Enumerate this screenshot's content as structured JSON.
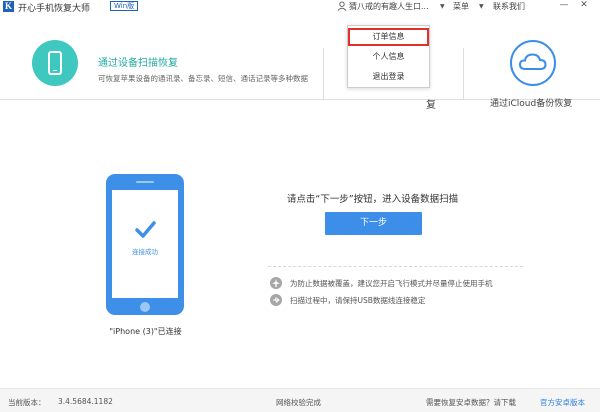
{
  "titlebar": {
    "logo_letter": "K",
    "app_title": "开心手机恢复大师",
    "edition": "Win版",
    "user_name": "猜八戒的有趣人生口...",
    "menu_label": "菜单",
    "contact_label": "联系我们",
    "minimize": "—",
    "close": "✕"
  },
  "options": {
    "device": {
      "title": "通过设备扫描恢复",
      "desc": "可恢复苹果设备的通讯录、备忘录、短信、通话记录等多种数据"
    },
    "itunes": {
      "title_tail": "复"
    },
    "icloud": {
      "title": "通过iCloud备份恢复"
    }
  },
  "dropdown": {
    "items": [
      "订单信息",
      "个人信息",
      "退出登录"
    ]
  },
  "main": {
    "connected_label": "连接成功",
    "device_caption": "\"iPhone (3)\"已连接",
    "instruction": "请点击“下一步”按钮，进入设备数据扫描",
    "next_button": "下一步",
    "tips": [
      "为防止数据被覆盖，建议您开启飞行模式并尽量停止使用手机",
      "扫描过程中，请保持USB数据线连接稳定"
    ]
  },
  "footer": {
    "version_label": "当前版本：",
    "version_value": "3.4.5684.1182",
    "network_status": "网络校验完成",
    "android_question": "需要恢复安卓数据？请下载",
    "android_link": "官方安卓版本"
  },
  "colors": {
    "brand_blue": "#3d8ee9",
    "teal": "#3ec8c0",
    "highlight_red": "#e23028"
  }
}
